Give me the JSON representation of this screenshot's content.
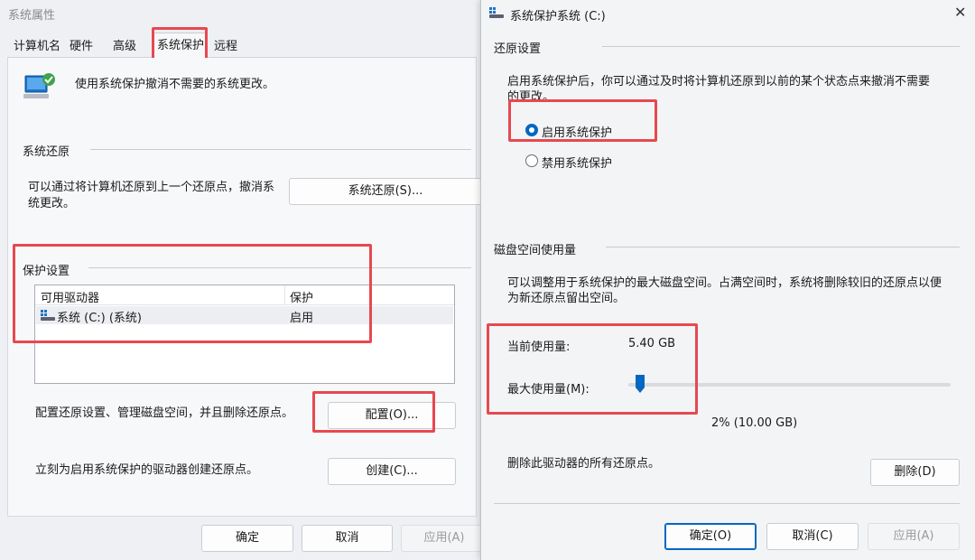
{
  "left": {
    "title": "系统属性",
    "tabs": [
      "计算机名",
      "硬件",
      "高级",
      "系统保护",
      "远程"
    ],
    "description": "使用系统保护撤消不需要的系统更改。",
    "restore_group": "系统还原",
    "restore_text_1": "可以通过将计算机还原到上一个还原点，撤消系",
    "restore_text_2": "统更改。",
    "restore_button": "系统还原(S)...",
    "protect_group": "保护设置",
    "columns": [
      "可用驱动器",
      "保护"
    ],
    "drives": [
      {
        "name": "系统 (C:) (系统)",
        "status": "启用"
      }
    ],
    "config_text": "配置还原设置、管理磁盘空间，并且删除还原点。",
    "config_button": "配置(O)...",
    "create_text": "立刻为启用系统保护的驱动器创建还原点。",
    "create_button": "创建(C)...",
    "ok": "确定",
    "cancel": "取消",
    "apply": "应用(A)"
  },
  "right": {
    "title": "系统保护系统 (C:)",
    "restore_group": "还原设置",
    "restore_desc_1": "启用系统保护后，你可以通过及时将计算机还原到以前的某个状态点来撤消不需要",
    "restore_desc_2": "的更改。",
    "radio_enable": "启用系统保护",
    "radio_disable": "禁用系统保护",
    "disk_group": "磁盘空间使用量",
    "disk_desc_1": "可以调整用于系统保护的最大磁盘空间。占满空间时，系统将删除较旧的还原点以便",
    "disk_desc_2": "为新还原点留出空间。",
    "current_label": "当前使用量:",
    "current_value": "5.40 GB",
    "max_label": "最大使用量(M):",
    "max_percent": 2,
    "max_display": "2% (10.00 GB)",
    "delete_text": "删除此驱动器的所有还原点。",
    "delete_button": "删除(D)",
    "ok": "确定(O)",
    "cancel": "取消(C)",
    "apply": "应用(A)",
    "close": "✕"
  },
  "colors": {
    "accent": "#0067c0",
    "highlight": "#e8484f"
  }
}
